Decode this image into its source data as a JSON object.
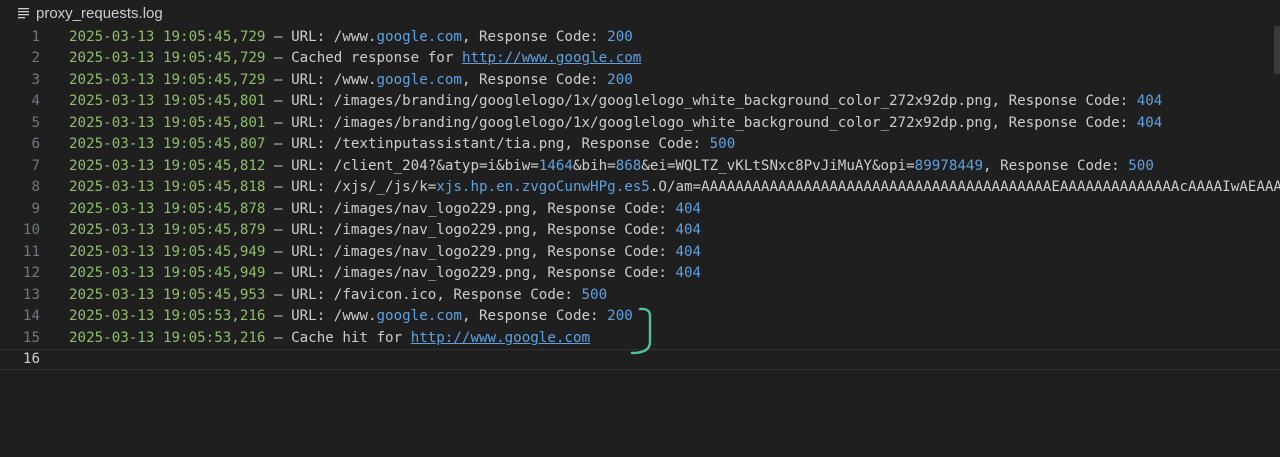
{
  "tab": {
    "filename": "proxy_requests.log",
    "icon": "file-lines-icon"
  },
  "colors": {
    "timestamp": "#8fbc6a",
    "number": "#5ea1e0",
    "text": "#cccccc",
    "background": "#1f1f1f",
    "annotation": "#4fc3a1"
  },
  "lines": [
    {
      "num": "1",
      "segments": [
        {
          "t": "2025-03-13 19:05:45,729",
          "c": "ts"
        },
        {
          "t": " – URL: /www.",
          "c": "plain"
        },
        {
          "t": "google.com",
          "c": "host"
        },
        {
          "t": ", Response Code: ",
          "c": "plain"
        },
        {
          "t": "200",
          "c": "num"
        }
      ]
    },
    {
      "num": "2",
      "segments": [
        {
          "t": "2025-03-13 19:05:45,729",
          "c": "ts"
        },
        {
          "t": " – Cached response for ",
          "c": "plain"
        },
        {
          "t": "http://www.google.com",
          "c": "link"
        }
      ]
    },
    {
      "num": "3",
      "segments": [
        {
          "t": "2025-03-13 19:05:45,729",
          "c": "ts"
        },
        {
          "t": " – URL: /www.",
          "c": "plain"
        },
        {
          "t": "google.com",
          "c": "host"
        },
        {
          "t": ", Response Code: ",
          "c": "plain"
        },
        {
          "t": "200",
          "c": "num"
        }
      ]
    },
    {
      "num": "4",
      "segments": [
        {
          "t": "2025-03-13 19:05:45,801",
          "c": "ts"
        },
        {
          "t": " – URL: /images/branding/googlelogo/1x/googlelogo_white_background_color_272x92dp.png, Response Code: ",
          "c": "plain"
        },
        {
          "t": "404",
          "c": "num"
        }
      ]
    },
    {
      "num": "5",
      "segments": [
        {
          "t": "2025-03-13 19:05:45,801",
          "c": "ts"
        },
        {
          "t": " – URL: /images/branding/googlelogo/1x/googlelogo_white_background_color_272x92dp.png, Response Code: ",
          "c": "plain"
        },
        {
          "t": "404",
          "c": "num"
        }
      ]
    },
    {
      "num": "6",
      "segments": [
        {
          "t": "2025-03-13 19:05:45,807",
          "c": "ts"
        },
        {
          "t": " – URL: /textinputassistant/tia.png, Response Code: ",
          "c": "plain"
        },
        {
          "t": "500",
          "c": "num"
        }
      ]
    },
    {
      "num": "7",
      "segments": [
        {
          "t": "2025-03-13 19:05:45,812",
          "c": "ts"
        },
        {
          "t": " – URL: /client_204?&atyp=i&biw=",
          "c": "plain"
        },
        {
          "t": "1464",
          "c": "num"
        },
        {
          "t": "&bih=",
          "c": "plain"
        },
        {
          "t": "868",
          "c": "num"
        },
        {
          "t": "&ei=WQLTZ_vKLtSNxc8PvJiMuAY&opi=",
          "c": "plain"
        },
        {
          "t": "89978449",
          "c": "num"
        },
        {
          "t": ", Response Code: ",
          "c": "plain"
        },
        {
          "t": "500",
          "c": "num"
        }
      ]
    },
    {
      "num": "8",
      "segments": [
        {
          "t": "2025-03-13 19:05:45,818",
          "c": "ts"
        },
        {
          "t": " – URL: /xjs/_/js/k=",
          "c": "plain"
        },
        {
          "t": "xjs.hp.en.zvgoCunwHPg.es5",
          "c": "host"
        },
        {
          "t": ".O/am=AAAAAAAAAAAAAAAAAAAAAAAAAAAAAAAAAAAAAAAAAEAAAAAAAAAAAAAAcAAAAIwAEAAA",
          "c": "plain"
        }
      ]
    },
    {
      "num": "9",
      "segments": [
        {
          "t": "2025-03-13 19:05:45,878",
          "c": "ts"
        },
        {
          "t": " – URL: /images/nav_logo229.png, Response Code: ",
          "c": "plain"
        },
        {
          "t": "404",
          "c": "num"
        }
      ]
    },
    {
      "num": "10",
      "segments": [
        {
          "t": "2025-03-13 19:05:45,879",
          "c": "ts"
        },
        {
          "t": " – URL: /images/nav_logo229.png, Response Code: ",
          "c": "plain"
        },
        {
          "t": "404",
          "c": "num"
        }
      ]
    },
    {
      "num": "11",
      "segments": [
        {
          "t": "2025-03-13 19:05:45,949",
          "c": "ts"
        },
        {
          "t": " – URL: /images/nav_logo229.png, Response Code: ",
          "c": "plain"
        },
        {
          "t": "404",
          "c": "num"
        }
      ]
    },
    {
      "num": "12",
      "segments": [
        {
          "t": "2025-03-13 19:05:45,949",
          "c": "ts"
        },
        {
          "t": " – URL: /images/nav_logo229.png, Response Code: ",
          "c": "plain"
        },
        {
          "t": "404",
          "c": "num"
        }
      ]
    },
    {
      "num": "13",
      "segments": [
        {
          "t": "2025-03-13 19:05:45,953",
          "c": "ts"
        },
        {
          "t": " – URL: /favicon.ico, Response Code: ",
          "c": "plain"
        },
        {
          "t": "500",
          "c": "num"
        }
      ]
    },
    {
      "num": "14",
      "segments": [
        {
          "t": "2025-03-13 19:05:53,216",
          "c": "ts"
        },
        {
          "t": " – URL: /www.",
          "c": "plain"
        },
        {
          "t": "google.com",
          "c": "host"
        },
        {
          "t": ", Response Code: ",
          "c": "plain"
        },
        {
          "t": "200",
          "c": "num"
        }
      ]
    },
    {
      "num": "15",
      "segments": [
        {
          "t": "2025-03-13 19:05:53,216",
          "c": "ts"
        },
        {
          "t": " – Cache hit for ",
          "c": "plain"
        },
        {
          "t": "http://www.google.com",
          "c": "link"
        }
      ]
    },
    {
      "num": "16",
      "segments": [],
      "current": true
    }
  ]
}
